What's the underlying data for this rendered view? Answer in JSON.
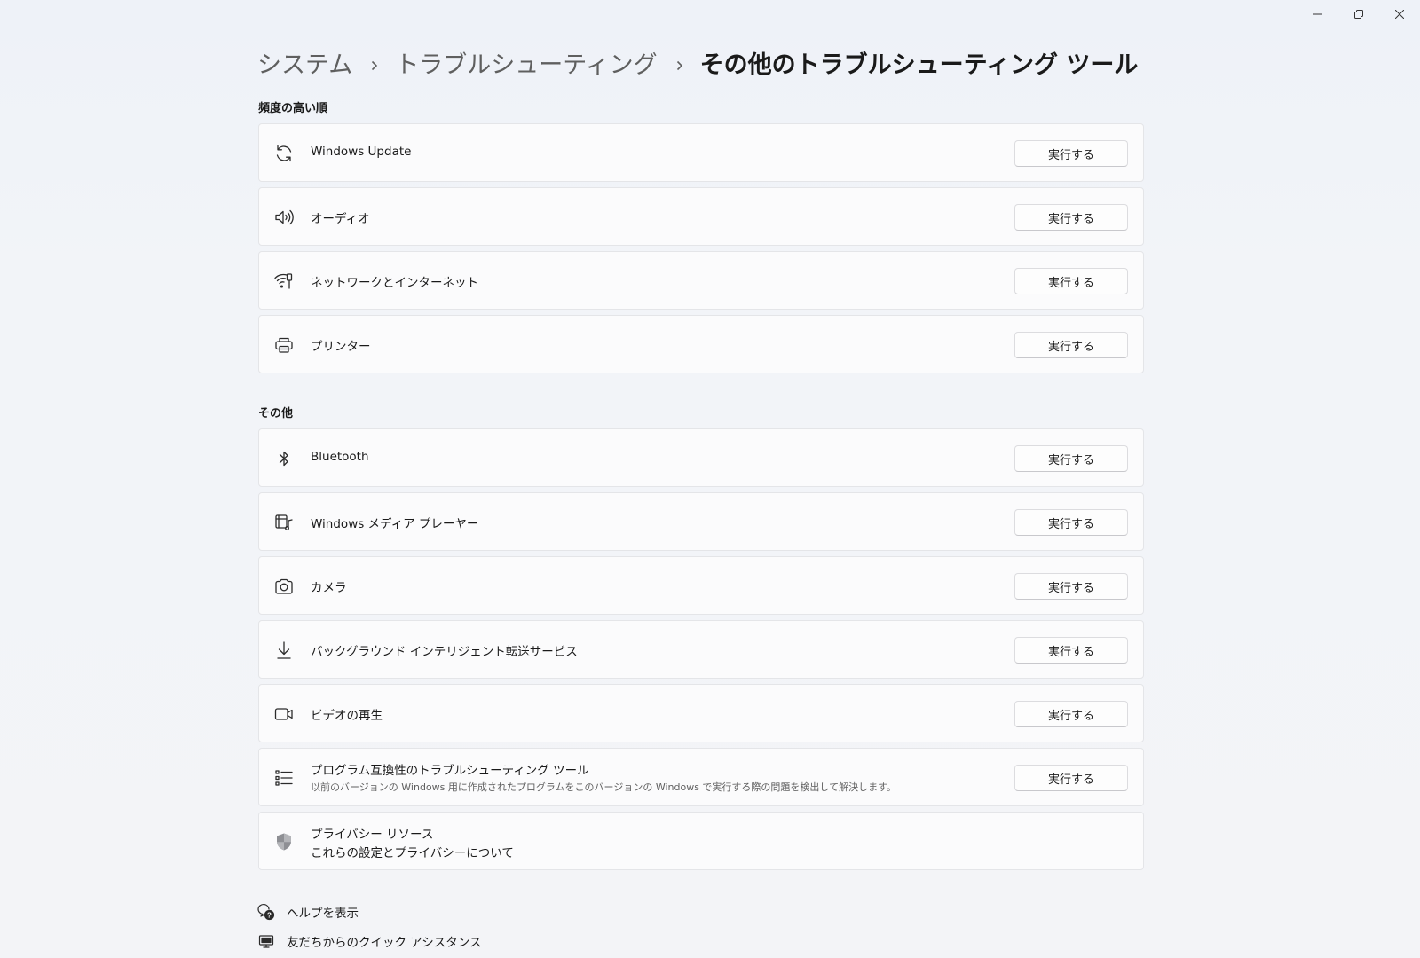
{
  "breadcrumb": {
    "items": [
      "システム",
      "トラブルシューティング",
      "その他のトラブルシューティング ツール"
    ]
  },
  "sections": {
    "frequent_title": "頻度の高い順",
    "other_title": "その他"
  },
  "run_label": "実行する",
  "frequent": [
    {
      "label": "Windows Update",
      "icon": "sync-icon"
    },
    {
      "label": "オーディオ",
      "icon": "speaker-icon"
    },
    {
      "label": "ネットワークとインターネット",
      "icon": "network-icon"
    },
    {
      "label": "プリンター",
      "icon": "printer-icon"
    }
  ],
  "other": [
    {
      "label": "Bluetooth",
      "icon": "bluetooth-icon"
    },
    {
      "label": "Windows メディア プレーヤー",
      "icon": "media-player-icon"
    },
    {
      "label": "カメラ",
      "icon": "camera-icon"
    },
    {
      "label": "バックグラウンド インテリジェント転送サービス",
      "icon": "download-icon"
    },
    {
      "label": "ビデオの再生",
      "icon": "video-icon"
    },
    {
      "label": "プログラム互換性のトラブルシューティング ツール",
      "description": "以前のバージョンの Windows 用に作成されたプログラムをこのバージョンの Windows で実行する際の問題を検出して解決します。",
      "icon": "list-icon"
    }
  ],
  "privacy": {
    "title": "プライバシー リソース",
    "link": "これらの設定とプライバシーについて",
    "icon": "shield-icon"
  },
  "footer": {
    "help": "ヘルプを表示",
    "quick_assist": "友だちからのクイック アシスタンス"
  },
  "window_controls": [
    "minimize-icon",
    "restore-icon",
    "close-icon"
  ]
}
